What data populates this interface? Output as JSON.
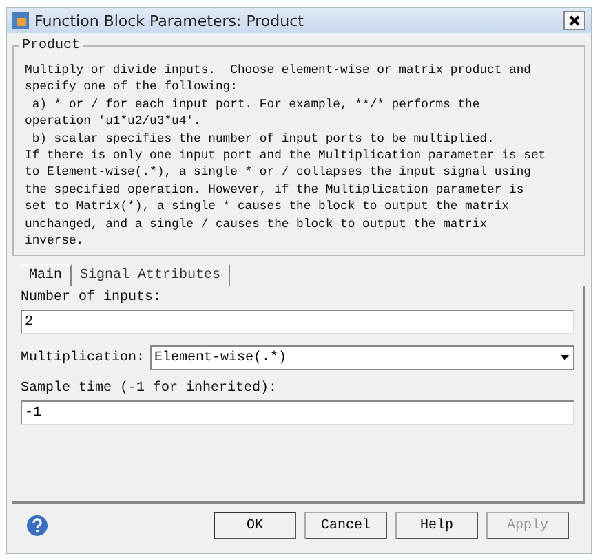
{
  "window": {
    "title": "Function Block Parameters: Product"
  },
  "group": {
    "title": "Product",
    "description": [
      "Multiply or divide inputs.  Choose element-wise or matrix product and",
      "specify one of the following:",
      " a) * or / for each input port. For example, **/* performs the",
      "operation 'u1*u2/u3*u4'.",
      " b) scalar specifies the number of input ports to be multiplied.",
      "If there is only one input port and the Multiplication parameter is set",
      "to Element-wise(.*), a single * or / collapses the input signal using",
      "the specified operation. However, if the Multiplication parameter is",
      "set to Matrix(*), a single * causes the block to output the matrix",
      "unchanged, and a single / causes the block to output the matrix",
      "inverse."
    ]
  },
  "tabs": [
    {
      "label": "Main",
      "selected": true
    },
    {
      "label": "Signal Attributes",
      "selected": false
    }
  ],
  "parameters": [
    {
      "kind": "text",
      "label": "Number of inputs:",
      "value": "2"
    },
    {
      "kind": "select",
      "label": "Multiplication:",
      "value": "Element-wise(.*)"
    },
    {
      "kind": "text",
      "label": "Sample time (-1 for inherited):",
      "value": "-1"
    }
  ],
  "buttons": [
    {
      "label": "OK",
      "disabled": false,
      "default": true
    },
    {
      "label": "Cancel",
      "disabled": false,
      "default": false
    },
    {
      "label": "Help",
      "disabled": false,
      "default": false
    },
    {
      "label": "Apply",
      "disabled": true,
      "default": false
    }
  ]
}
